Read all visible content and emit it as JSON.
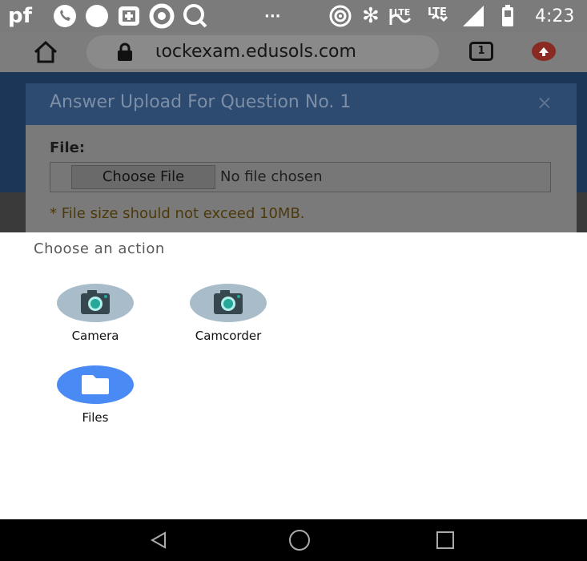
{
  "status_bar": {
    "carrier": "pf",
    "time": "4:23"
  },
  "browser": {
    "url": "ιockexam.edusols.com",
    "tab_count": "1"
  },
  "modal": {
    "title": "Answer Upload For Question No. 1",
    "close": "×",
    "file_label": "File:",
    "choose_button": "Choose File",
    "no_file": "No file chosen",
    "size_note": "* File size should not exceed 10MB."
  },
  "chooser": {
    "title": "Choose an action",
    "apps": [
      {
        "label": "Camera",
        "icon": "camera-icon"
      },
      {
        "label": "Camcorder",
        "icon": "camcorder-icon"
      },
      {
        "label": "Files",
        "icon": "folder-icon"
      }
    ]
  },
  "colors": {
    "camera_icon_bg": "#a8bcc9",
    "files_icon_bg": "#4a8af4"
  }
}
